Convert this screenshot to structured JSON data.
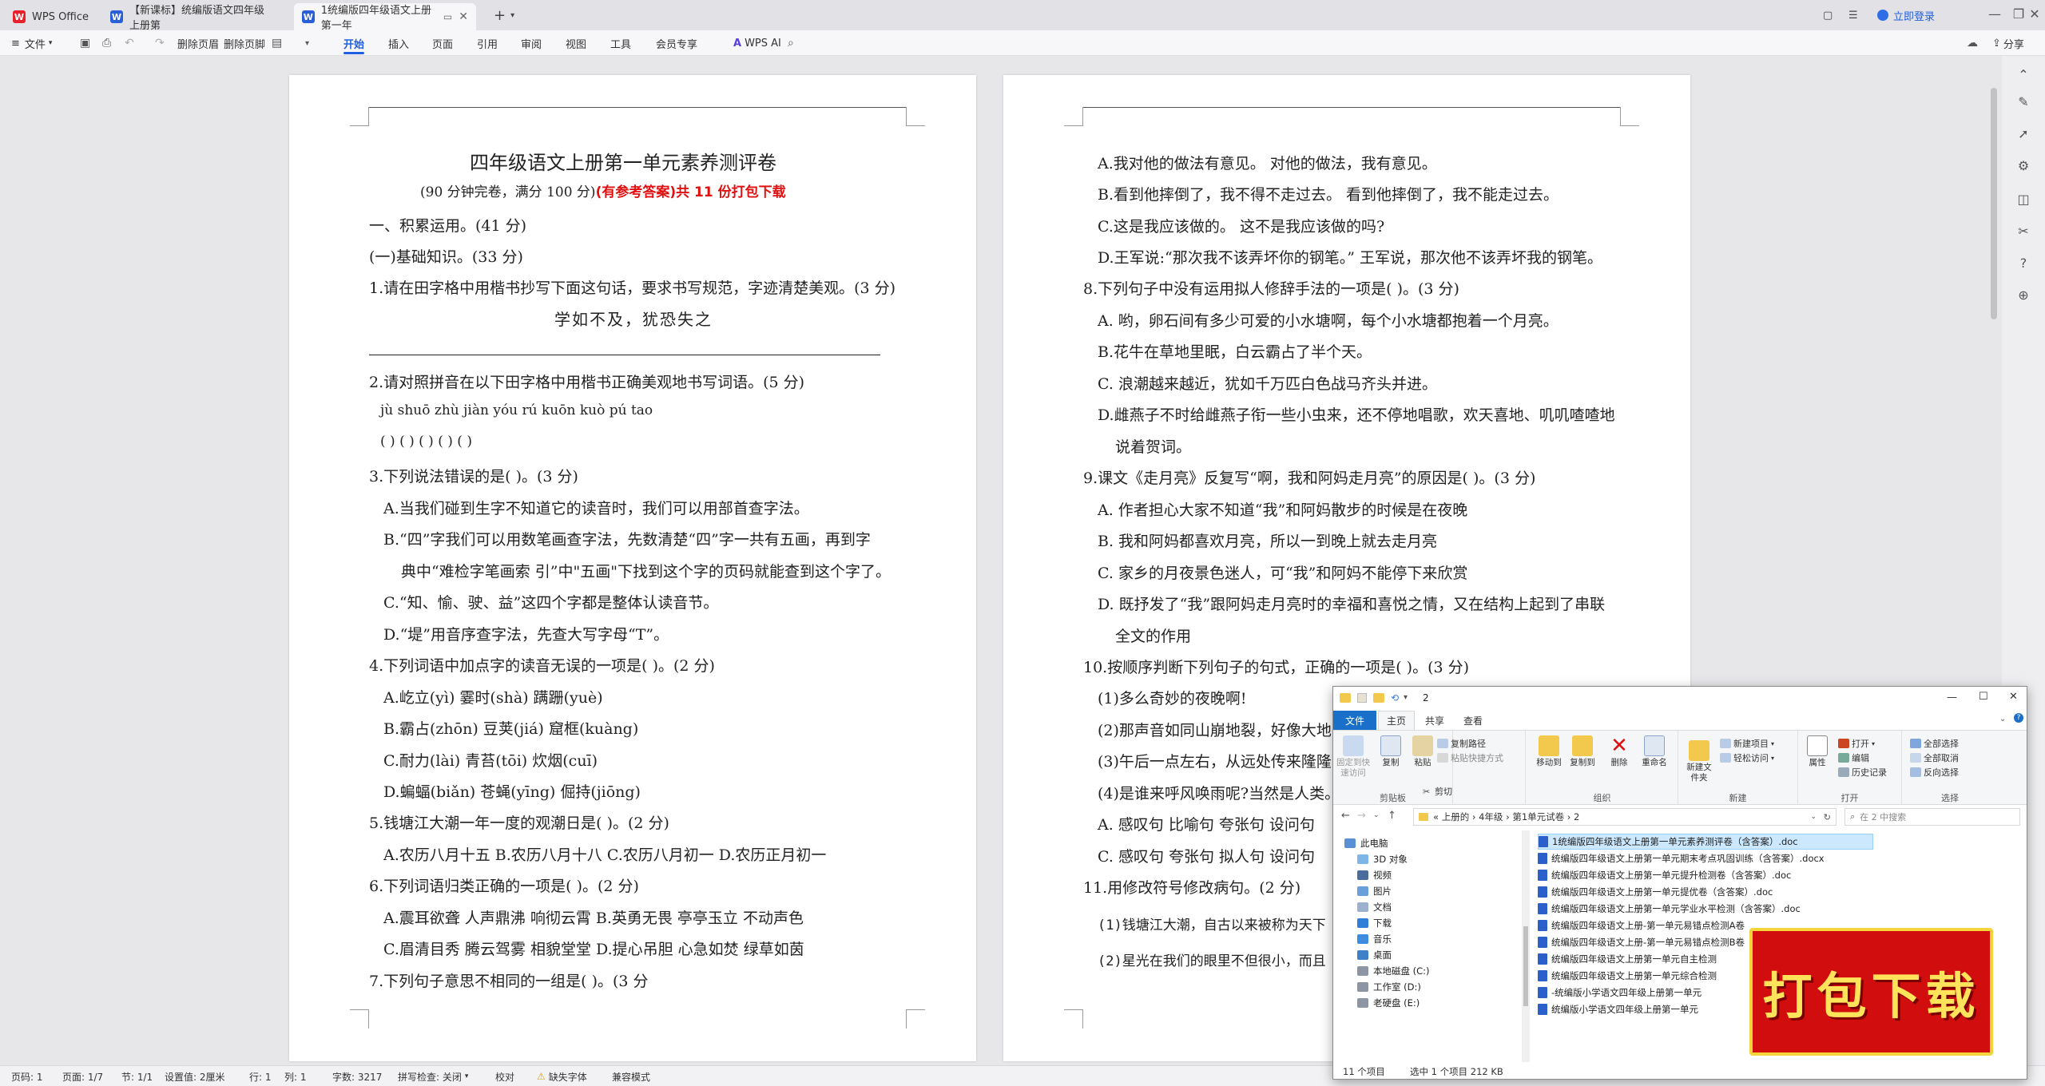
{
  "titlebar": {
    "app_tab": "WPS Office",
    "tab1": "【新课标】统编版语文四年级上册第",
    "tab2": "1统编版四年级语文上册第一年",
    "login": "立即登录"
  },
  "ribbon": {
    "file": "文件",
    "delete_header": "删除页眉",
    "delete_footer": "删除页脚",
    "tabs": [
      "开始",
      "插入",
      "页面",
      "引用",
      "审阅",
      "视图",
      "工具",
      "会员专享"
    ],
    "wps_ai": "WPS AI",
    "share": "分享"
  },
  "page1": {
    "title": "四年级语文上册第一单元素养测评卷",
    "subtitle_prefix": "(90 分钟完卷，满分 100 分)",
    "subtitle_red": "(有参考答案)共 11 份打包下载",
    "lines": [
      "一、积累运用。(41 分)",
      "(一)基础知识。(33 分)",
      "1.请在田字格中用楷书抄写下面这句话，要求书写规范，字迹清楚美观。(3 分)",
      "2.请对照拼音在以下田字格中用楷书正确美观地书写词语。(5 分)",
      "jù    shuō            zhù    jiàn              yóu    rú                    kuōn    kuò              pú    tao",
      "(                )       (                )       (                )       (                )       (                )",
      "3.下列说法错误的是(        )。(3 分)",
      "A.当我们碰到生字不知道它的读音时，我们可以用部首查字法。",
      "B.“四”字我们可以用数笔画查字法，先数清楚“四”字一共有五画，再到字",
      "典中“难检字笔画索  引”中\"五画\"下找到这个字的页码就能查到这个字了。",
      "C.“知、愉、驶、益”这四个字都是整体认读音节。",
      "D.“堤”用音序查字法，先查大写字母“T”。",
      "4.下列词语中加点字的读音无误的一项是(        )。(2 分)",
      "A.屹立(yì)              霎时(shà)             蹒跚(yuè)",
      "B.霸占(zhōn)           豆荚(jiá)              窟框(kuàng)",
      "C.耐力(lài)              青苔(tōi)              炊烟(cuī)",
      "D.蝙蝠(biǎn)            苍蝇(yīng)             倔持(jiōng)",
      "5.钱塘江大潮一年一度的观潮日是(        )。(2 分)",
      "A.农历八月十五      B.农历八月十八      C.农历八月初一      D.农历正月初一",
      "6.下列词语归类正确的一项是(        )。(2 分)",
      "A.震耳欲聋  人声鼎沸  响彻云霄                    B.英勇无畏   亭亭玉立  不动声色",
      "C.眉清目秀   腾云驾雾  相貌堂堂                  D.提心吊胆  心急如焚  绿草如茵",
      "7.下列句子意思不相同的一组是(        )。(3 分"
    ],
    "calligraphy": "学如不及，犹恐失之"
  },
  "page2": {
    "lines": [
      "A.我对他的做法有意见。                                 对他的做法，我有意见。",
      "B.看到他摔倒了，我不得不走过去。                  看到他摔倒了，我不能走过去。",
      "C.这是我应该做的。                                         这不是我应该做的吗?",
      "D.王军说:“那次我不该弄坏你的钢笔。”       王军说，那次他不该弄坏我的钢笔。",
      "8.下列句子中没有运用拟人修辞手法的一项是(        )。(3 分)",
      "A. 哟，卵石间有多少可爱的小水塘啊，每个小水塘都抱着一个月亮。",
      "B.花牛在草地里眠，白云霸占了半个天。",
      "C. 浪潮越来越近，犹如千万匹白色战马齐头并进。",
      "D.雌燕子不时给雌燕子衔一些小虫来，还不停地唱歌，欢天喜地、叽叽喳喳地",
      "说着贺词。",
      "9.课文《走月亮》反复写“啊，我和阿妈走月亮”的原因是(          )。(3 分)",
      "A. 作者担心大家不知道“我”和阿妈散步的时候是在夜晚",
      "B. 我和阿妈都喜欢月亮，所以一到晚上就去走月亮",
      "C. 家乡的月夜景色迷人，可“我”和阿妈不能停下来欣赏",
      "D. 既抒发了“我”跟阿妈走月亮时的幸福和喜悦之情，又在结构上起到了串联",
      "全文的作用",
      "10.按顺序判断下列句子的句式，正确的一项是(        )。(3 分)",
      "(1)多么奇妙的夜晚啊!",
      "(2)那声音如同山崩地裂，好像大地",
      "(3)午后一点左右，从远处传来隆隆",
      "(4)是谁来呼风唤雨呢?当然是人类。",
      "A. 感叹句  比喻句  夸张句  设问句",
      "C. 感叹句  夸张句  拟人句    设问句",
      "11.用修改符号修改病句。(2 分)",
      "(1)钱塘江大潮，自古以来被称为天下",
      "(2)星光在我们的眼里不但很小，而且"
    ]
  },
  "statusbar": {
    "items": [
      "页码: 1",
      "页面: 1/7",
      "节: 1/1",
      "设置值: 2厘米",
      "行: 1",
      "列: 1",
      "字数: 3217",
      "拼写检查: 关闭",
      "校对",
      "缺失字体",
      "兼容模式"
    ]
  },
  "explorer": {
    "title_num": "2",
    "tabs": [
      "文件",
      "主页",
      "共享",
      "查看"
    ],
    "ribbon": {
      "pin": "固定到快速访问",
      "copy": "复制",
      "paste": "粘贴",
      "copy_path": "复制路径",
      "paste_shortcut": "粘贴快捷方式",
      "cut": "剪切",
      "clipboard": "剪贴板",
      "move_to": "移动到",
      "copy_to": "复制到",
      "delete": "删除",
      "rename": "重命名",
      "organize": "组织",
      "new_folder": "新建文件夹",
      "new_item": "新建项目",
      "easy_access": "轻松访问",
      "new": "新建",
      "properties": "属性",
      "open": "打开",
      "edit": "编辑",
      "history": "历史记录",
      "open_group": "打开",
      "select_all": "全部选择",
      "select_none": "全部取消",
      "invert": "反向选择",
      "select_group": "选择"
    },
    "address": "«  上册的  ›  4年级  ›  第1单元试卷  ›  2",
    "search_placeholder": "在 2 中搜索",
    "nav": [
      "此电脑",
      "3D 对象",
      "视频",
      "图片",
      "文档",
      "下载",
      "音乐",
      "桌面",
      "本地磁盘 (C:)",
      "工作室 (D:)",
      "老硬盘 (E:)"
    ],
    "files": [
      "1统编版四年级语文上册第一单元素养测评卷（含答案）.doc",
      "统编版四年级语文上册第一单元期末考点巩固训练（含答案）.docx",
      "统编版四年级语文上册第一单元提升检测卷（含答案）.doc",
      "统编版四年级语文上册第一单元提优卷（含答案）.doc",
      "统编版四年级语文上册第一单元学业水平检测（含答案）.doc",
      "统编版四年级语文上册-第一单元易错点检测A卷",
      "统编版四年级语文上册-第一单元易错点检测B卷",
      "统编版四年级语文上册第一单元自主检测",
      "统编版四年级语文上册第一单元综合检测",
      "-统编版小学语文四年级上册第一单元",
      "统编版小学语文四年级上册第一单元"
    ],
    "status_count": "11 个项目",
    "status_selected": "选中 1 个项目  212 KB"
  },
  "promo": "打包下载",
  "colors": {
    "accent": "#1f5fe0",
    "red": "#e01010",
    "explorer_file_tab": "#1a6fc9"
  }
}
